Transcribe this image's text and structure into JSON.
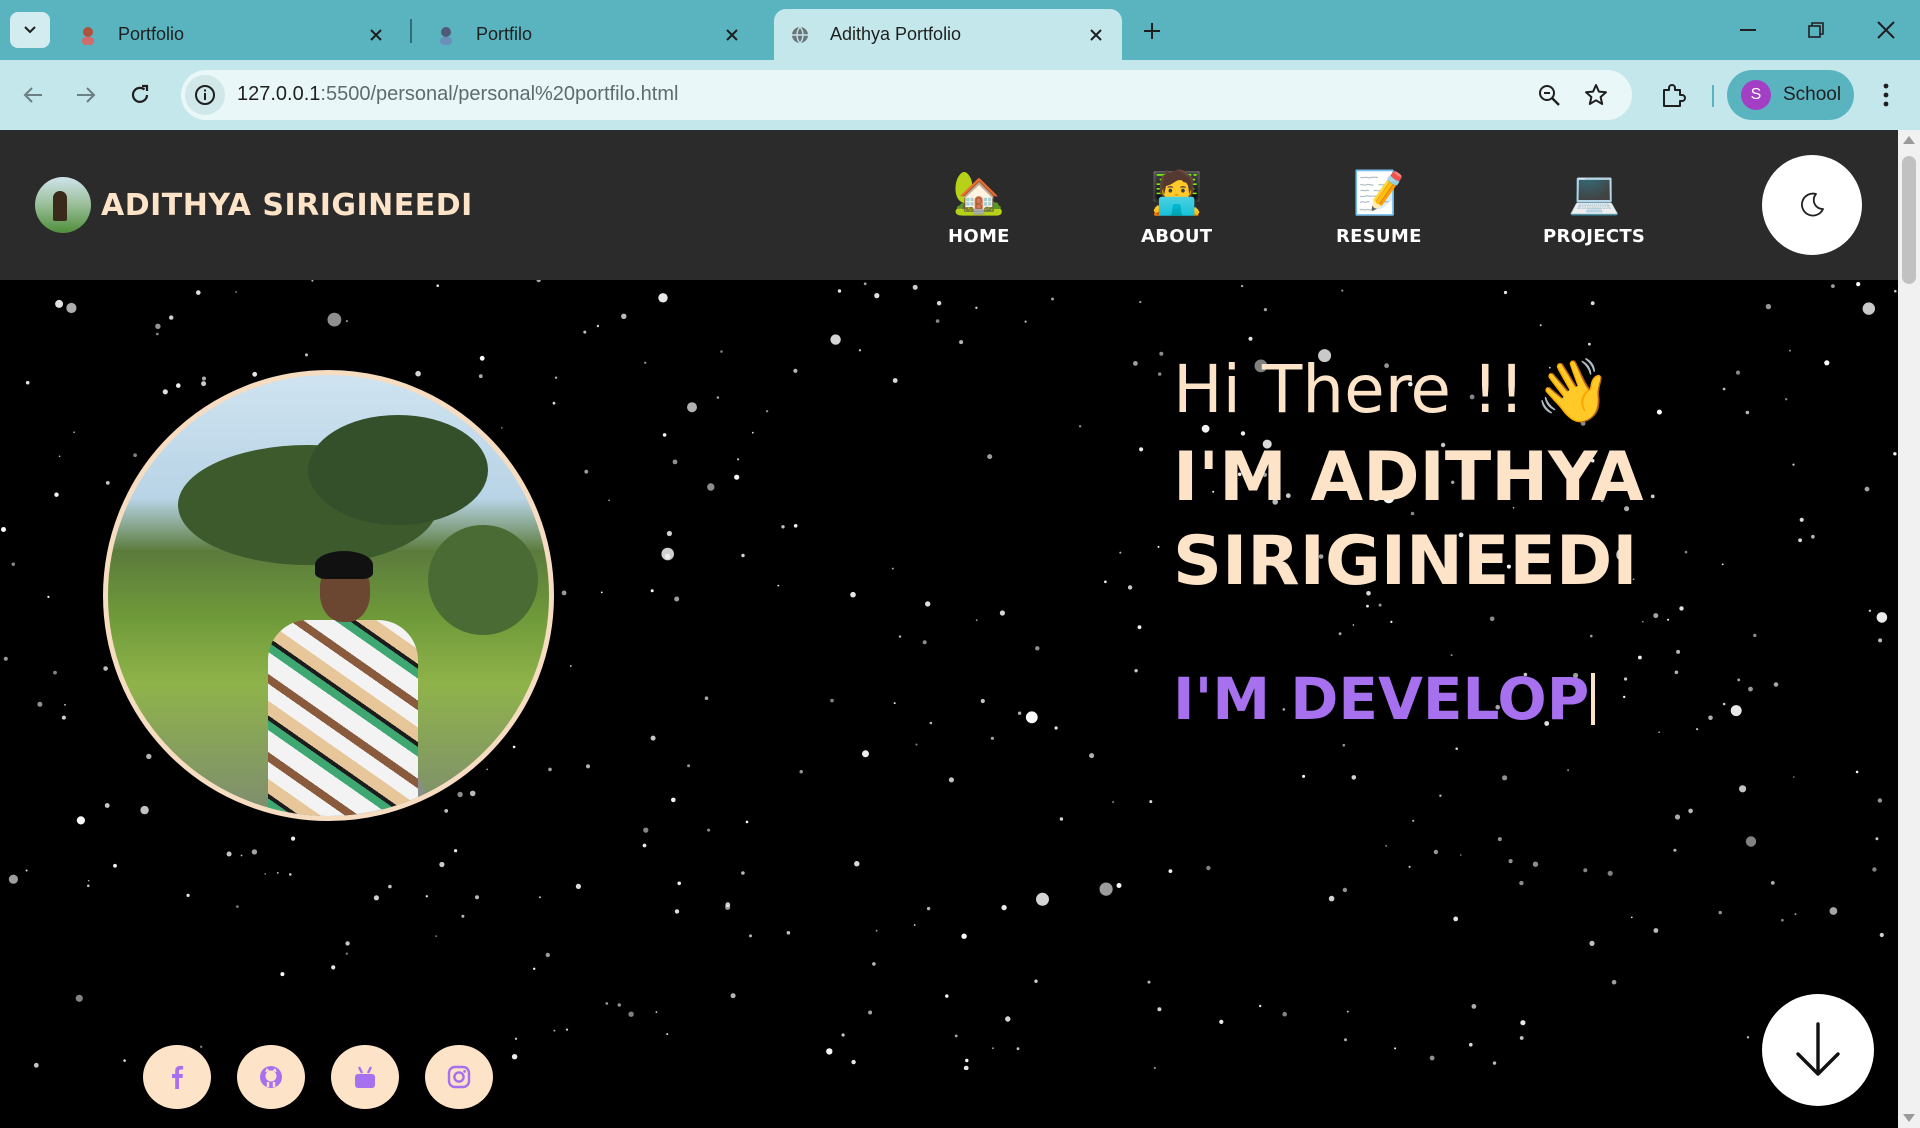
{
  "browser": {
    "tabs": [
      {
        "title": "Portfolio",
        "active": false,
        "favicon": "person-avatar-icon"
      },
      {
        "title": "Portfilo",
        "active": false,
        "favicon": "person-avatar-icon"
      },
      {
        "title": "Adithya Portfolio",
        "active": true,
        "favicon": "globe-icon"
      }
    ],
    "url_host": "127.0.0.1",
    "url_path": ":5500/personal/personal%20portfilo.html",
    "profile_initial": "S",
    "profile_name": "School",
    "colors": {
      "frame": "#5ab4c0",
      "toolbar": "#c4e7ec"
    }
  },
  "site": {
    "brand_name": "ADITHYA SIRIGINEEDI",
    "nav": [
      {
        "label": "HOME",
        "emoji": "🏡"
      },
      {
        "label": "ABOUT",
        "emoji": "🧑‍💻"
      },
      {
        "label": "RESUME",
        "emoji": "📝"
      },
      {
        "label": "PROJECTS",
        "emoji": "💻"
      }
    ],
    "hero": {
      "greeting": "Hi There !!",
      "wave_emoji": "👋",
      "name_line1": "I'M ADITHYA",
      "name_line2": "SIRIGINEEDI",
      "typed_role": "I'M DEVELOP"
    },
    "social_icons": [
      "facebook-icon",
      "github-icon",
      "youtube-icon",
      "instagram-icon"
    ],
    "colors": {
      "accent": "#fde3c7",
      "role": "#a770ef",
      "nav_bg": "#2b2b2b",
      "background": "#000000"
    }
  }
}
